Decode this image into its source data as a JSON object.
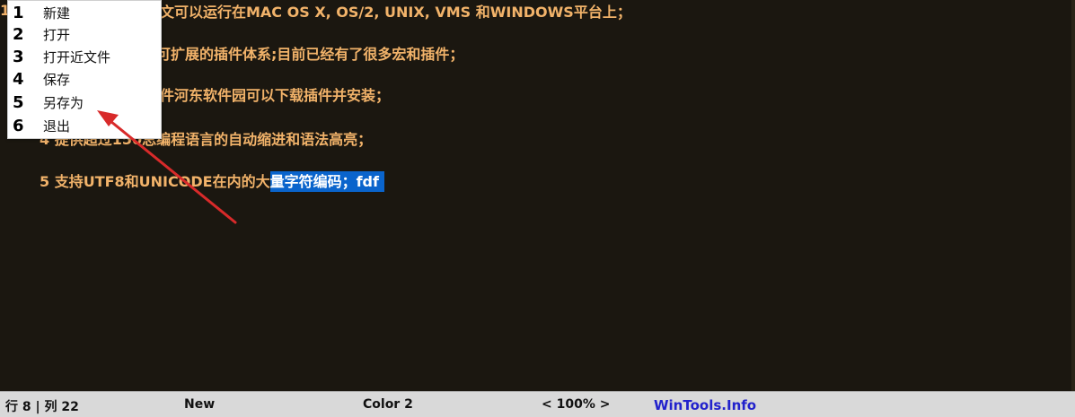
{
  "editor": {
    "lines": [
      {
        "text": "文可以运行在MAC OS X, OS/2, UNIX, VMS 和WINDOWS平台上；"
      },
      {
        "text": "可扩展的插件体系;目前已经有了很多宏和插件；"
      },
      {
        "text": "件河东软件园可以下载插件并安装；"
      },
      {
        "text": "4 提供超过150总编程语言的自动缩进和语法高亮；"
      },
      {
        "text_plain": "5 支持UTF8和UNICODE在内的大",
        "text_selected": "量字符编码；fdf"
      }
    ],
    "left_edge_char": "1"
  },
  "menu": {
    "items": [
      {
        "num": "1",
        "label": "新建"
      },
      {
        "num": "2",
        "label": "打开"
      },
      {
        "num": "3",
        "label": "打开近文件"
      },
      {
        "num": "4",
        "label": "保存"
      },
      {
        "num": "5",
        "label": "另存为"
      },
      {
        "num": "6",
        "label": "退出"
      }
    ]
  },
  "status": {
    "position": "行 8 | 列 22",
    "mode": "New",
    "color_scheme": "Color 2",
    "zoom": "< 100% >",
    "brand": "WinTools.Info"
  },
  "colors": {
    "background": "#1b1710",
    "text": "#f2b36a",
    "selection": "#0a64cc",
    "annotation_arrow": "#d82a2a",
    "brand": "#2222cc"
  },
  "annotation": {
    "icon": "red-arrow-icon"
  }
}
